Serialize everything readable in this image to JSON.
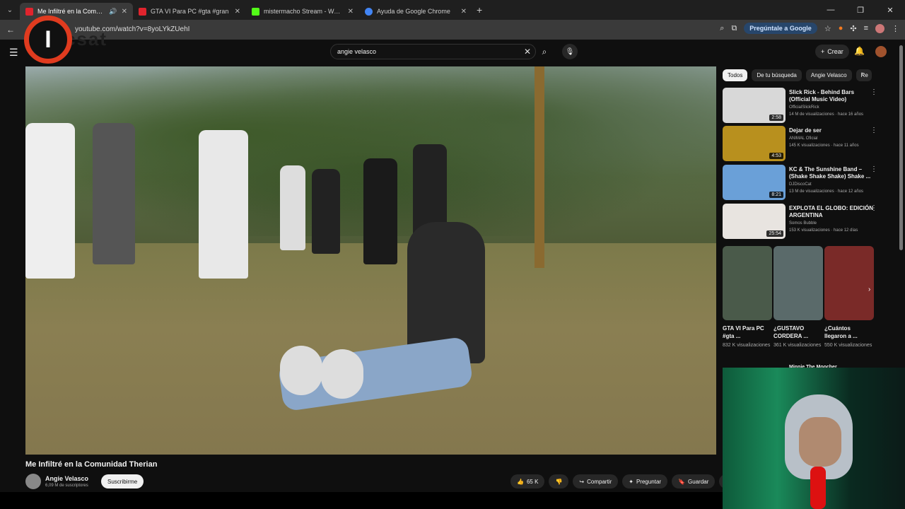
{
  "browser": {
    "tabs": [
      {
        "title": "Me Infiltré en la Comunidad Therian",
        "active": true,
        "favicon_color": "#e0242d"
      },
      {
        "title": "GTA VI Para PC #gta #gran",
        "active": false,
        "favicon_color": "#e0242d"
      },
      {
        "title": "mistermacho Stream - Watch Live",
        "active": false,
        "favicon_color": "#53fc18"
      },
      {
        "title": "Ayuda de Google Chrome",
        "active": false,
        "favicon_color": "#4285f4"
      }
    ],
    "url": "youtube.com/watch?v=8yoLYkZUehI",
    "ask_google": "Pregúntale a Google"
  },
  "overlay_logo": {
    "letter": "I",
    "text": "csat"
  },
  "youtube": {
    "search_value": "angie velasco",
    "create_label": "Crear",
    "video": {
      "title": "Me Infiltré en la Comunidad Therian",
      "channel": "Angie Velasco",
      "subscribers": "6,09 M de suscriptores",
      "subscribe_label": "Suscribirme",
      "likes": "65 K",
      "share_label": "Compartir",
      "ask_label": "Preguntar",
      "save_label": "Guardar"
    },
    "filters": [
      "Todos",
      "De tu búsqueda",
      "Angie Velasco",
      "Re"
    ],
    "recommendations": [
      {
        "title": "Slick Rick - Behind Bars (Official Music Video)",
        "channel": "OfficialSlickRick",
        "meta": "14 M de visualizaciones · hace 16 años",
        "duration": "2:58",
        "color": "#d8d8d8"
      },
      {
        "title": "Dejar de ser",
        "channel": "ANIMAL Oficial",
        "meta": "145 K visualizaciones · hace 11 años",
        "duration": "4:53",
        "color": "#b8901e"
      },
      {
        "title": "KC & The Sunshine Band – (Shake Shake Shake) Shake ...",
        "channel": "DJDiscoCat",
        "meta": "13 M de visualizaciones · hace 12 años",
        "duration": "8:21",
        "color": "#6aa0d8"
      },
      {
        "title": "EXPLOTA EL GLOBO: EDICIÓN ARGENTINA",
        "channel": "Somos Bubble",
        "meta": "153 K visualizaciones · hace 12 días",
        "duration": "25:54",
        "color": "#e8e4e0"
      }
    ],
    "shorts": [
      {
        "title": "GTA VI Para PC #gta ...",
        "views": "832 K visualizaciones",
        "color": "#4a5a4a"
      },
      {
        "title": "¿GUSTAVO CORDERA ...",
        "views": "361 K visualizaciones",
        "color": "#5a6a6a"
      },
      {
        "title": "¿Cuántos llegaron a ...",
        "views": "550 K visualizaciones",
        "color": "#7a2a28"
      }
    ],
    "extra_title": "Minnie The Moocher"
  }
}
